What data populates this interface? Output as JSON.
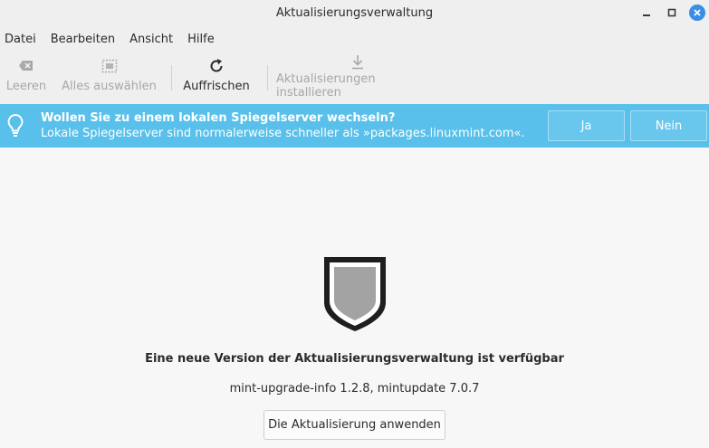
{
  "window": {
    "title": "Aktualisierungsverwaltung",
    "minimize_icon": "minimize-icon",
    "maximize_icon": "maximize-icon",
    "close_icon": "close-icon",
    "accent": "#3a8ee6"
  },
  "menubar": {
    "items": [
      "Datei",
      "Bearbeiten",
      "Ansicht",
      "Hilfe"
    ]
  },
  "toolbar": {
    "clear": {
      "label": "Leeren",
      "icon": "clear-icon",
      "enabled": false
    },
    "select_all": {
      "label": "Alles auswählen",
      "icon": "select-all-icon",
      "enabled": false
    },
    "refresh": {
      "label": "Auffrischen",
      "icon": "refresh-icon",
      "enabled": true
    },
    "install": {
      "label": "Aktualisierungen installieren",
      "icon": "download-icon",
      "enabled": false
    }
  },
  "infobar": {
    "color": "#58c0ea",
    "icon": "lightbulb-icon",
    "title": "Wollen Sie zu einem lokalen Spiegelserver wechseln?",
    "message": "Lokale Spiegelserver sind normalerweise schneller als »packages.linuxmint.com«.",
    "yes_label": "Ja",
    "no_label": "Nein"
  },
  "main": {
    "icon": "shield-icon",
    "heading": "Eine neue Version der Aktualisierungsverwaltung ist verfügbar",
    "versions": "mint-upgrade-info 1.2.8, mintupdate 7.0.7",
    "apply_label": "Die Aktualisierung anwenden"
  }
}
